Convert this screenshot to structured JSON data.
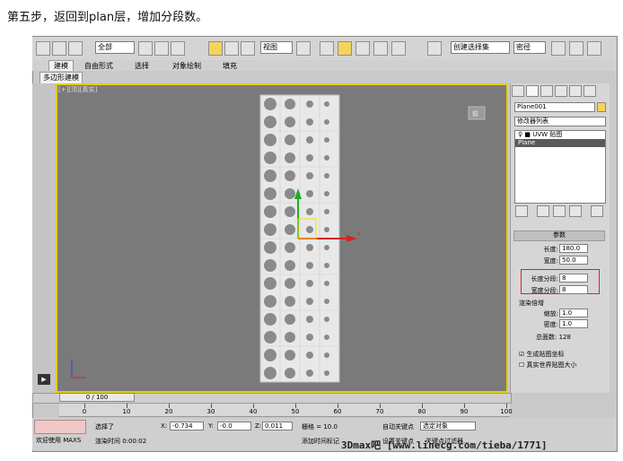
{
  "caption": "第五步，返回到plan层，增加分段数。",
  "toolbar": {
    "selection_filter": "全部",
    "view_dropdown": "视图",
    "named_selection": "创建选择集",
    "extra": "密径"
  },
  "ribbon": {
    "tabs": [
      "建模",
      "自由形式",
      "选择",
      "对象绘制",
      "填充"
    ],
    "active_tab": "建模",
    "sub_tab": "多边形建模"
  },
  "viewport": {
    "label": "[+][顶][真实]",
    "viewcube_label": "前"
  },
  "command_panel": {
    "object_name": "Plane001",
    "modifier_list": "修改器列表",
    "stack": [
      "UVW 贴图",
      "Plane"
    ],
    "rollout_title": "参数",
    "length_label": "长度:",
    "length_value": "180.0",
    "width_label": "宽度:",
    "width_value": "50.0",
    "length_segs_label": "长度分段:",
    "length_segs_value": "8",
    "width_segs_label": "宽度分段:",
    "width_segs_value": "8",
    "render_multipliers": "渲染倍增",
    "scale_label": "缩放:",
    "scale_value": "1.0",
    "density_label": "密度:",
    "density_value": "1.0",
    "total_faces": "总面数: 128",
    "gen_map_coords": "生成贴图坐标",
    "real_world": "真实世界贴图大小"
  },
  "timeline": {
    "slider_label": "0 / 100",
    "ticks": [
      "0",
      "10",
      "20",
      "30",
      "40",
      "50",
      "60",
      "70",
      "80",
      "90",
      "100"
    ]
  },
  "status": {
    "welcome": "欢迎使用 MAXS",
    "selected": "选择了",
    "x_label": "X:",
    "x_value": "-0.734",
    "y_label": "Y:",
    "y_value": "-0.0",
    "z_label": "Z:",
    "z_value": "0.011",
    "grid": "栅格 = 10.0",
    "render_time": "渲染时间 0:00:02",
    "add_time_tag": "添加时间标记",
    "auto_key": "自动关键点",
    "selected_object": "选定对象",
    "set_key": "设置关键点",
    "key_filters": "关键点过滤器..."
  },
  "watermark": "3Dmax吧 [www.linecg.com/tieba/1771]"
}
